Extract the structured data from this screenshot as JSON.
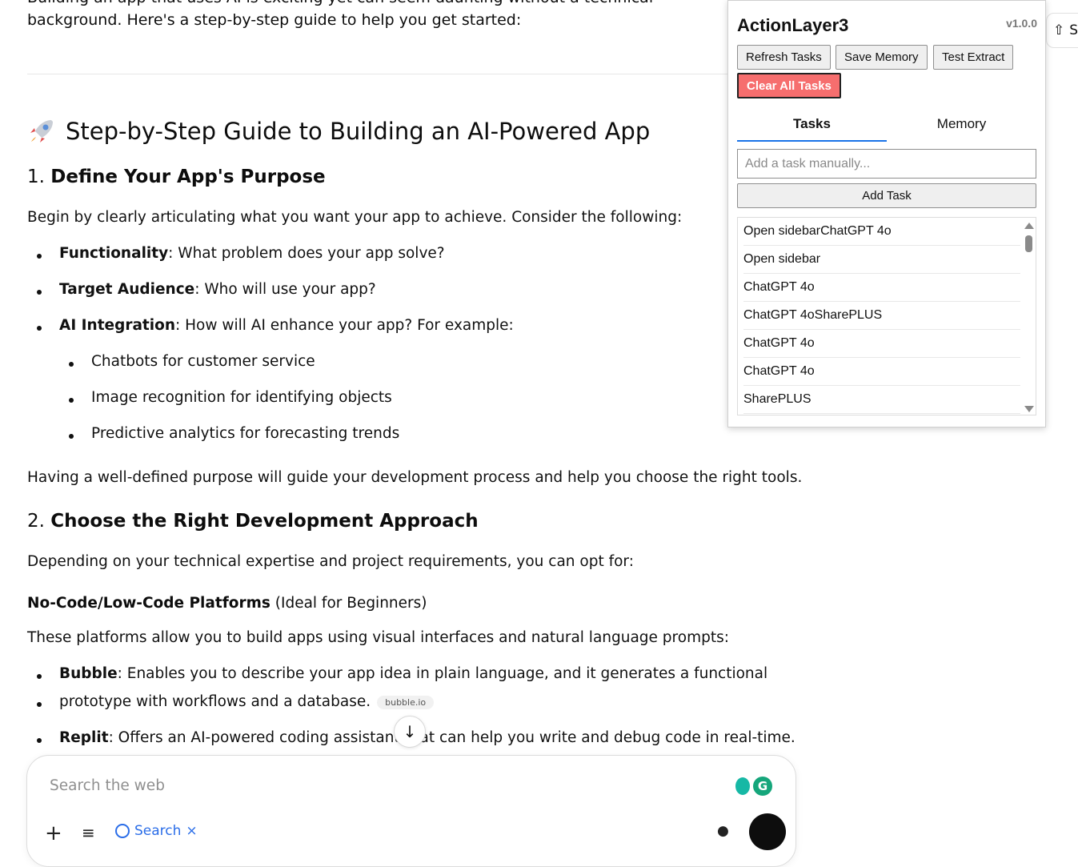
{
  "article": {
    "cut_line": "Building an app that uses AI is exciting yet can seem daunting without a technical",
    "intro": "background. Here's a step-by-step guide to help you get started:",
    "heading": "Step-by-Step Guide to Building an AI-Powered App",
    "section1": {
      "num": "1.",
      "title": "Define Your App's Purpose",
      "lead": "Begin by clearly articulating what you want your app to achieve. Consider the following:",
      "items": [
        {
          "term": "Functionality",
          "text": ": What problem does your app solve?"
        },
        {
          "term": "Target Audience",
          "text": ": Who will use your app?"
        },
        {
          "term": "AI Integration",
          "text": ": How will AI enhance your app? For example:"
        }
      ],
      "subitems": [
        "Chatbots for customer service",
        "Image recognition for identifying objects",
        "Predictive analytics for forecasting trends"
      ],
      "closing": "Having a well-defined purpose will guide your development process and help you choose the right tools."
    },
    "section2": {
      "num": "2.",
      "title": "Choose the Right Development Approach",
      "lead": "Depending on your technical expertise and project requirements, you can opt for:",
      "sub_heading_bold": "No-Code/Low-Code Platforms",
      "sub_heading_rest": " (Ideal for Beginners)",
      "sub_lead": "These platforms allow you to build apps using visual interfaces and natural language prompts:",
      "bubble_term": "Bubble",
      "bubble_text1": ": Enables you to describe your app idea in plain language, and it generates a functional",
      "bubble_text2": "prototype with workflows and a database.",
      "bubble_chip": "bubble.io",
      "replit_term": "Replit",
      "replit_text": ": Offers an AI-powered coding assistant that can help you write and debug code in real-time."
    }
  },
  "composer": {
    "placeholder": "Search the web",
    "search_label": "Search",
    "search_close": "×",
    "grammarly_letter": "G"
  },
  "share": {
    "label": "Sh"
  },
  "panel": {
    "title": "ActionLayer3",
    "version": "v1.0.0",
    "buttons": {
      "refresh": "Refresh Tasks",
      "save_memory": "Save Memory",
      "test_extract": "Test Extract",
      "clear_all": "Clear All Tasks"
    },
    "tabs": {
      "tasks": "Tasks",
      "memory": "Memory",
      "active": "tasks"
    },
    "task_input_placeholder": "Add a task manually...",
    "add_task": "Add Task",
    "tasks": [
      "Open sidebarChatGPT 4o",
      "Open sidebar",
      "ChatGPT 4o",
      "ChatGPT 4oSharePLUS",
      "ChatGPT 4o",
      "ChatGPT 4o",
      "SharePLUS"
    ],
    "colors": {
      "danger": "#f66e6e",
      "tab_accent": "#1a73e8"
    }
  }
}
